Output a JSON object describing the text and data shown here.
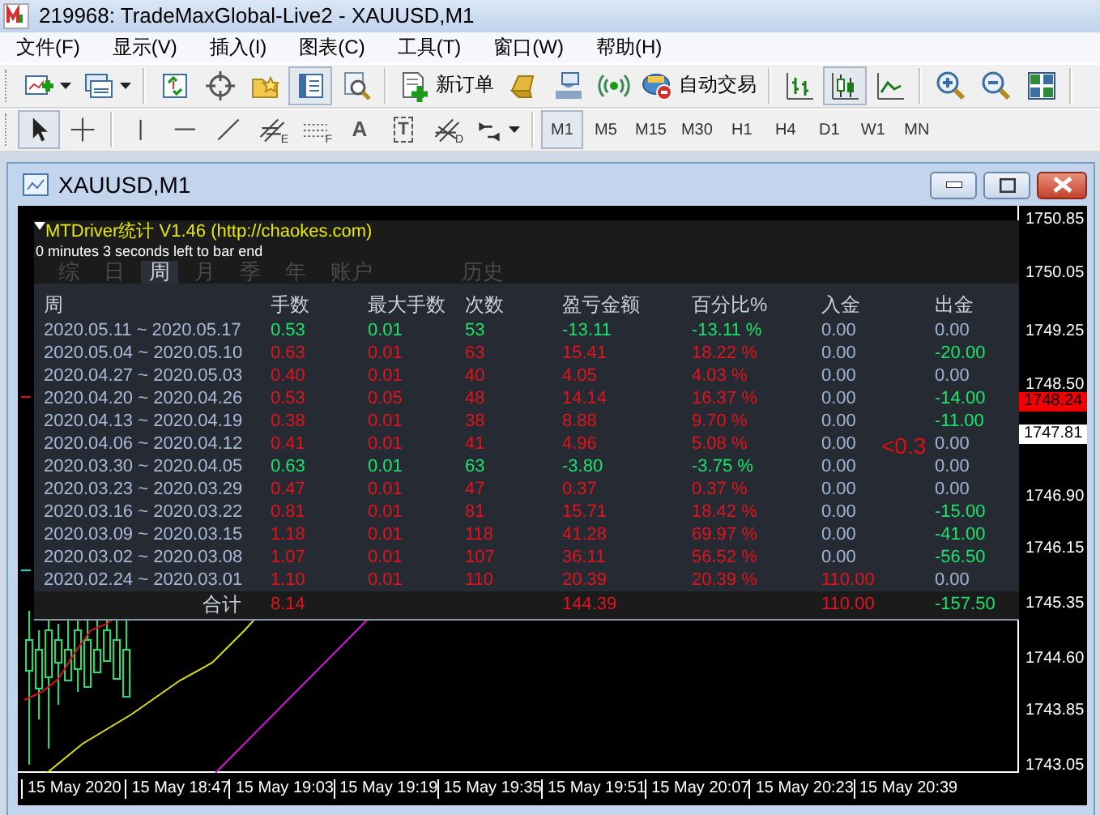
{
  "window": {
    "title": "219968: TradeMaxGlobal-Live2 - XAUUSD,M1"
  },
  "menu": [
    "文件(F)",
    "显示(V)",
    "插入(I)",
    "图表(C)",
    "工具(T)",
    "窗口(W)",
    "帮助(H)"
  ],
  "toolbar_main": [
    {
      "kind": "button",
      "pressed": false,
      "has_menu": true
    },
    {
      "kind": "button",
      "pressed": false,
      "has_menu": true
    },
    {
      "kind": "separator"
    },
    {
      "kind": "button",
      "pressed": false
    },
    {
      "kind": "button",
      "pressed": false
    },
    {
      "kind": "button",
      "pressed": false
    },
    {
      "kind": "button",
      "pressed": true
    },
    {
      "kind": "button",
      "pressed": false
    },
    {
      "kind": "separator"
    },
    {
      "kind": "button",
      "pressed": false,
      "label": "新订单"
    },
    {
      "kind": "button",
      "pressed": false
    },
    {
      "kind": "button",
      "pressed": false
    },
    {
      "kind": "button",
      "pressed": false
    },
    {
      "kind": "button",
      "pressed": false,
      "label": "自动交易"
    },
    {
      "kind": "separator"
    },
    {
      "kind": "button",
      "pressed": false
    },
    {
      "kind": "button",
      "pressed": true
    },
    {
      "kind": "button",
      "pressed": false
    },
    {
      "kind": "separator"
    },
    {
      "kind": "button",
      "pressed": false
    },
    {
      "kind": "button",
      "pressed": false
    },
    {
      "kind": "button",
      "pressed": false
    },
    {
      "kind": "separator"
    }
  ],
  "toolbar_draw": [
    {
      "kind": "button",
      "pressed": true
    },
    {
      "kind": "button",
      "pressed": false
    },
    {
      "kind": "separator"
    },
    {
      "kind": "button",
      "pressed": false
    },
    {
      "kind": "button",
      "pressed": false
    },
    {
      "kind": "button",
      "pressed": false
    },
    {
      "kind": "button",
      "pressed": false,
      "badge": "E"
    },
    {
      "kind": "button",
      "pressed": false,
      "badge": "F"
    },
    {
      "kind": "button",
      "pressed": false,
      "glyph": "A"
    },
    {
      "kind": "button",
      "pressed": false,
      "glyph": "T"
    },
    {
      "kind": "button",
      "pressed": false,
      "badge": "D"
    },
    {
      "kind": "button",
      "pressed": false,
      "has_menu": true
    },
    {
      "kind": "separator"
    }
  ],
  "timeframes": [
    {
      "label": "M1",
      "selected": true
    },
    {
      "label": "M5",
      "selected": false
    },
    {
      "label": "M15",
      "selected": false
    },
    {
      "label": "M30",
      "selected": false
    },
    {
      "label": "H1",
      "selected": false
    },
    {
      "label": "H4",
      "selected": false
    },
    {
      "label": "D1",
      "selected": false
    },
    {
      "label": "W1",
      "selected": false
    },
    {
      "label": "MN",
      "selected": false
    }
  ],
  "chart_window": {
    "title": "XAUUSD,M1",
    "marker_text": "<0.3",
    "price_axis": [
      {
        "text": "1750.85",
        "kind": "tick"
      },
      {
        "text": "1750.05",
        "kind": "tick"
      },
      {
        "text": "1749.25",
        "kind": "tick"
      },
      {
        "text": "1748.50",
        "kind": "tick"
      },
      {
        "text": "1748.24",
        "kind": "bid"
      },
      {
        "text": "1747.81",
        "kind": "ask"
      },
      {
        "text": "1746.90",
        "kind": "tick"
      },
      {
        "text": "1746.15",
        "kind": "tick"
      },
      {
        "text": "1745.35",
        "kind": "tick"
      },
      {
        "text": "1744.60",
        "kind": "tick"
      },
      {
        "text": "1743.85",
        "kind": "tick"
      },
      {
        "text": "1743.05",
        "kind": "tick"
      }
    ],
    "time_axis": [
      "15 May 2020",
      "15 May 18:47",
      "15 May 19:03",
      "15 May 19:19",
      "15 May 19:35",
      "15 May 19:51",
      "15 May 20:07",
      "15 May 20:23",
      "15 May 20:39"
    ]
  },
  "panel": {
    "title": "MTDriver统计 V1.46  (http://chaokes.com)",
    "countdown": "0 minutes 3 seconds left to bar end",
    "tabs": [
      {
        "label": "综",
        "selected": false
      },
      {
        "label": "日",
        "selected": false
      },
      {
        "label": "周",
        "selected": true
      },
      {
        "label": "月",
        "selected": false
      },
      {
        "label": "季",
        "selected": false
      },
      {
        "label": "年",
        "selected": false
      },
      {
        "label": "账户",
        "selected": false
      },
      {
        "label": "历史",
        "selected": false
      }
    ],
    "columns": [
      "周",
      "手数",
      "最大手数",
      "次数",
      "盈亏金额",
      "百分比%",
      "入金",
      "出金"
    ],
    "rows": [
      {
        "week": "2020.05.11 ~ 2020.05.17",
        "values": [
          {
            "text": "0.53",
            "color": "#19e36a"
          },
          {
            "text": "0.01",
            "color": "#19e36a"
          },
          {
            "text": "53",
            "color": "#19e36a"
          },
          {
            "text": "-13.11",
            "color": "#19e36a"
          },
          {
            "text": "-13.11 %",
            "color": "#19e36a"
          },
          {
            "text": "0.00",
            "color": "#9fb3d3"
          },
          {
            "text": "0.00",
            "color": "#9fb3d3"
          }
        ]
      },
      {
        "week": "2020.05.04 ~ 2020.05.10",
        "values": [
          {
            "text": "0.63",
            "color": "#e0141c"
          },
          {
            "text": "0.01",
            "color": "#e0141c"
          },
          {
            "text": "63",
            "color": "#e0141c"
          },
          {
            "text": "15.41",
            "color": "#e0141c"
          },
          {
            "text": "18.22 %",
            "color": "#e0141c"
          },
          {
            "text": "0.00",
            "color": "#9fb3d3"
          },
          {
            "text": "-20.00",
            "color": "#19e36a"
          }
        ]
      },
      {
        "week": "2020.04.27 ~ 2020.05.03",
        "values": [
          {
            "text": "0.40",
            "color": "#e0141c"
          },
          {
            "text": "0.01",
            "color": "#e0141c"
          },
          {
            "text": "40",
            "color": "#e0141c"
          },
          {
            "text": "4.05",
            "color": "#e0141c"
          },
          {
            "text": "4.03 %",
            "color": "#e0141c"
          },
          {
            "text": "0.00",
            "color": "#9fb3d3"
          },
          {
            "text": "0.00",
            "color": "#9fb3d3"
          }
        ]
      },
      {
        "week": "2020.04.20 ~ 2020.04.26",
        "values": [
          {
            "text": "0.53",
            "color": "#e0141c"
          },
          {
            "text": "0.05",
            "color": "#e0141c"
          },
          {
            "text": "48",
            "color": "#e0141c"
          },
          {
            "text": "14.14",
            "color": "#e0141c"
          },
          {
            "text": "16.37 %",
            "color": "#e0141c"
          },
          {
            "text": "0.00",
            "color": "#9fb3d3"
          },
          {
            "text": "-14.00",
            "color": "#19e36a"
          }
        ]
      },
      {
        "week": "2020.04.13 ~ 2020.04.19",
        "values": [
          {
            "text": "0.38",
            "color": "#e0141c"
          },
          {
            "text": "0.01",
            "color": "#e0141c"
          },
          {
            "text": "38",
            "color": "#e0141c"
          },
          {
            "text": "8.88",
            "color": "#e0141c"
          },
          {
            "text": "9.70 %",
            "color": "#e0141c"
          },
          {
            "text": "0.00",
            "color": "#9fb3d3"
          },
          {
            "text": "-11.00",
            "color": "#19e36a"
          }
        ]
      },
      {
        "week": "2020.04.06 ~ 2020.04.12",
        "values": [
          {
            "text": "0.41",
            "color": "#e0141c"
          },
          {
            "text": "0.01",
            "color": "#e0141c"
          },
          {
            "text": "41",
            "color": "#e0141c"
          },
          {
            "text": "4.96",
            "color": "#e0141c"
          },
          {
            "text": "5.08 %",
            "color": "#e0141c"
          },
          {
            "text": "0.00",
            "color": "#9fb3d3"
          },
          {
            "text": "0.00",
            "color": "#9fb3d3"
          }
        ]
      },
      {
        "week": "2020.03.30 ~ 2020.04.05",
        "values": [
          {
            "text": "0.63",
            "color": "#19e36a"
          },
          {
            "text": "0.01",
            "color": "#19e36a"
          },
          {
            "text": "63",
            "color": "#19e36a"
          },
          {
            "text": "-3.80",
            "color": "#19e36a"
          },
          {
            "text": "-3.75 %",
            "color": "#19e36a"
          },
          {
            "text": "0.00",
            "color": "#9fb3d3"
          },
          {
            "text": "0.00",
            "color": "#9fb3d3"
          }
        ]
      },
      {
        "week": "2020.03.23 ~ 2020.03.29",
        "values": [
          {
            "text": "0.47",
            "color": "#e0141c"
          },
          {
            "text": "0.01",
            "color": "#e0141c"
          },
          {
            "text": "47",
            "color": "#e0141c"
          },
          {
            "text": "0.37",
            "color": "#e0141c"
          },
          {
            "text": "0.37 %",
            "color": "#e0141c"
          },
          {
            "text": "0.00",
            "color": "#9fb3d3"
          },
          {
            "text": "0.00",
            "color": "#9fb3d3"
          }
        ]
      },
      {
        "week": "2020.03.16 ~ 2020.03.22",
        "values": [
          {
            "text": "0.81",
            "color": "#e0141c"
          },
          {
            "text": "0.01",
            "color": "#e0141c"
          },
          {
            "text": "81",
            "color": "#e0141c"
          },
          {
            "text": "15.71",
            "color": "#e0141c"
          },
          {
            "text": "18.42 %",
            "color": "#e0141c"
          },
          {
            "text": "0.00",
            "color": "#9fb3d3"
          },
          {
            "text": "-15.00",
            "color": "#19e36a"
          }
        ]
      },
      {
        "week": "2020.03.09 ~ 2020.03.15",
        "values": [
          {
            "text": "1.18",
            "color": "#e0141c"
          },
          {
            "text": "0.01",
            "color": "#e0141c"
          },
          {
            "text": "118",
            "color": "#e0141c"
          },
          {
            "text": "41.28",
            "color": "#e0141c"
          },
          {
            "text": "69.97 %",
            "color": "#e0141c"
          },
          {
            "text": "0.00",
            "color": "#9fb3d3"
          },
          {
            "text": "-41.00",
            "color": "#19e36a"
          }
        ]
      },
      {
        "week": "2020.03.02 ~ 2020.03.08",
        "values": [
          {
            "text": "1.07",
            "color": "#e0141c"
          },
          {
            "text": "0.01",
            "color": "#e0141c"
          },
          {
            "text": "107",
            "color": "#e0141c"
          },
          {
            "text": "36.11",
            "color": "#e0141c"
          },
          {
            "text": "56.52 %",
            "color": "#e0141c"
          },
          {
            "text": "0.00",
            "color": "#9fb3d3"
          },
          {
            "text": "-56.50",
            "color": "#19e36a"
          }
        ]
      },
      {
        "week": "2020.02.24 ~ 2020.03.01",
        "values": [
          {
            "text": "1.10",
            "color": "#e0141c"
          },
          {
            "text": "0.01",
            "color": "#e0141c"
          },
          {
            "text": "110",
            "color": "#e0141c"
          },
          {
            "text": "20.39",
            "color": "#e0141c"
          },
          {
            "text": "20.39 %",
            "color": "#e0141c"
          },
          {
            "text": "110.00",
            "color": "#e0141c"
          },
          {
            "text": "0.00",
            "color": "#9fb3d3"
          }
        ]
      }
    ],
    "total": {
      "label": "合计",
      "lots": {
        "text": "8.14",
        "color": "#e0141c"
      },
      "profit": {
        "text": "144.39",
        "color": "#e0141c"
      },
      "deposit": {
        "text": "110.00",
        "color": "#e0141c"
      },
      "withdrawal": {
        "text": "-157.50",
        "color": "#19e36a"
      }
    }
  }
}
